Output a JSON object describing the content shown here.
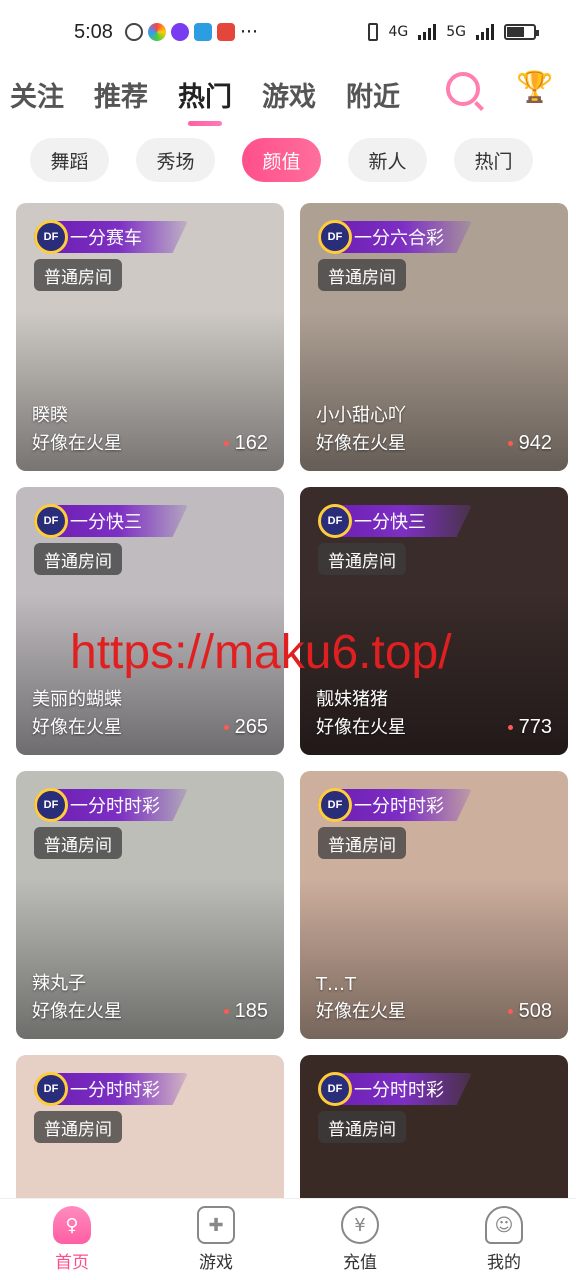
{
  "status_bar": {
    "time": "5:08",
    "network_1": "4G",
    "network_2": "5G",
    "more": "···"
  },
  "tabs": [
    {
      "label": "关注"
    },
    {
      "label": "推荐"
    },
    {
      "label": "热门",
      "active": true
    },
    {
      "label": "游戏"
    },
    {
      "label": "附近"
    }
  ],
  "chips": [
    {
      "label": "舞蹈"
    },
    {
      "label": "秀场"
    },
    {
      "label": "颜值",
      "active": true
    },
    {
      "label": "新人"
    },
    {
      "label": "热门"
    }
  ],
  "cards": [
    {
      "game": "一分赛车",
      "room": "普通房间",
      "name": "睽睽",
      "location": "好像在火星",
      "count": "162",
      "bg": "#d9d4cf"
    },
    {
      "game": "一分六合彩",
      "room": "普通房间",
      "name": "小小甜心吖",
      "location": "好像在火星",
      "count": "942",
      "bg": "#b8a99c"
    },
    {
      "game": "一分快三",
      "room": "普通房间",
      "name": "美丽的蝴蝶",
      "location": "好像在火星",
      "count": "265",
      "bg": "#c9c5c9"
    },
    {
      "game": "一分快三",
      "room": "普通房间",
      "name": "靓妹猪猪",
      "location": "好像在火星",
      "count": "773",
      "bg": "#3c2e2c"
    },
    {
      "game": "一分时时彩",
      "room": "普通房间",
      "name": "辣丸子",
      "location": "好像在火星",
      "count": "185",
      "bg": "#c7c8c2"
    },
    {
      "game": "一分时时彩",
      "room": "普通房间",
      "name": "T…T",
      "location": "好像在火星",
      "count": "508",
      "bg": "#d8b8a6"
    },
    {
      "game": "一分时时彩",
      "room": "普通房间",
      "name": "",
      "location": "",
      "count": "",
      "bg": "#e6cfc4"
    },
    {
      "game": "一分时时彩",
      "room": "普通房间",
      "name": "",
      "location": "",
      "count": "",
      "bg": "#3a2a26"
    }
  ],
  "game_logo_text": "DF",
  "watermark": "https://maku6.top/",
  "bottom_nav": [
    {
      "label": "首页",
      "icon": "home-girl-icon",
      "active": true
    },
    {
      "label": "游戏",
      "icon": "gamepad-icon"
    },
    {
      "label": "充值",
      "icon": "yen-coin-icon"
    },
    {
      "label": "我的",
      "icon": "user-icon"
    }
  ],
  "colors": {
    "accent": "#ff4f8b",
    "badge_purple": "#6a1bb0"
  }
}
